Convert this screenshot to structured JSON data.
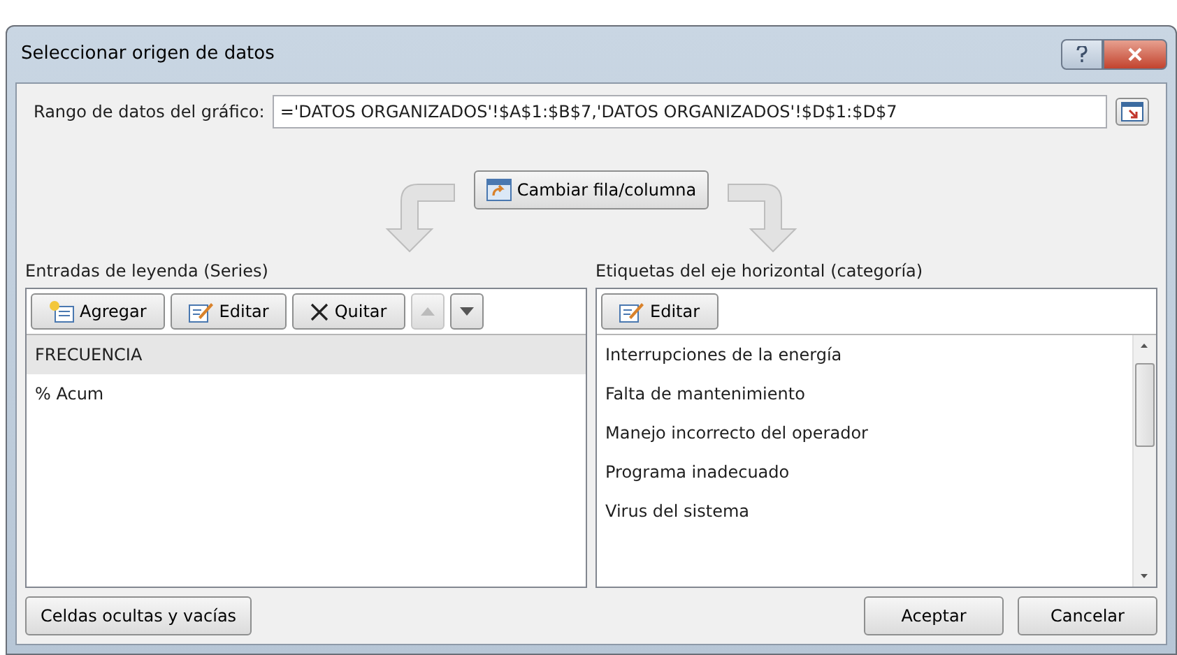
{
  "window": {
    "title": "Seleccionar origen de datos"
  },
  "range": {
    "label": "Rango de datos del gráfico:",
    "value": "='DATOS ORGANIZADOS'!$A$1:$B$7,'DATOS ORGANIZADOS'!$D$1:$D$7"
  },
  "swap_button": "Cambiar fila/columna",
  "series_panel": {
    "title": "Entradas de leyenda (Series)",
    "toolbar": [
      {
        "kind": "add",
        "label": "Agregar",
        "disabled": false
      },
      {
        "kind": "edit",
        "label": "Editar",
        "disabled": false
      },
      {
        "kind": "remove",
        "label": "Quitar",
        "disabled": false
      },
      {
        "kind": "up",
        "disabled": true
      },
      {
        "kind": "down",
        "disabled": false
      }
    ],
    "items": [
      {
        "label": "FRECUENCIA",
        "selected": true
      },
      {
        "label": "% Acum",
        "selected": false
      }
    ]
  },
  "category_panel": {
    "title": "Etiquetas del eje horizontal (categoría)",
    "toolbar": [
      {
        "kind": "edit",
        "label": "Editar",
        "disabled": false
      }
    ],
    "items": [
      {
        "label": "Interrupciones de la energía",
        "selected": false
      },
      {
        "label": "Falta de mantenimiento",
        "selected": false
      },
      {
        "label": "Manejo incorrecto del operador",
        "selected": false
      },
      {
        "label": "Programa inadecuado",
        "selected": false
      },
      {
        "label": "Virus del sistema",
        "selected": false
      }
    ]
  },
  "buttons": {
    "left": "Celdas ocultas y vacías",
    "ok": "Aceptar",
    "cancel": "Cancelar"
  }
}
